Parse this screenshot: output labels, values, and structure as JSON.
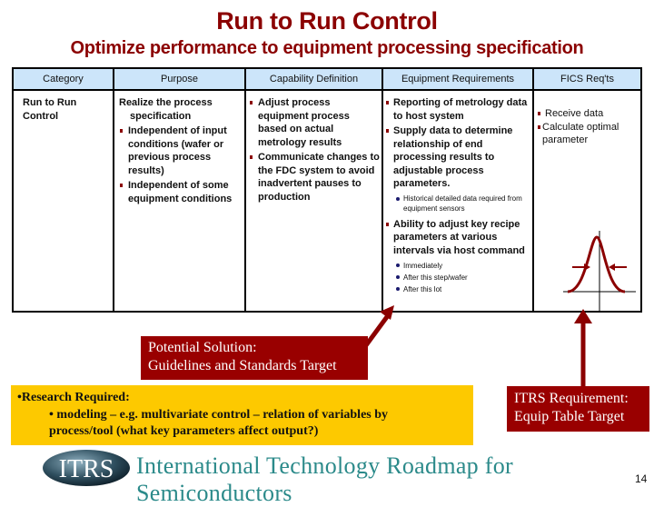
{
  "title": "Run to Run Control",
  "subtitle": "Optimize performance to equipment processing specification",
  "table": {
    "headers": [
      "Category",
      "Purpose",
      "Capability Definition",
      "Equipment Requirements",
      "FICS Req'ts"
    ],
    "category": [
      "Run to Run",
      "Control"
    ],
    "purpose": {
      "intro": "Realize the process specification",
      "bullets": [
        "Independent of input conditions (wafer or previous process results)",
        "Independent of some equipment conditions"
      ]
    },
    "capability": {
      "bullets": [
        "Adjust process equipment process based on actual metrology results",
        "Communicate changes to the FDC system to avoid inadvertent pauses to production"
      ]
    },
    "equipment": {
      "b1": "Reporting of metrology data to host system",
      "b2": "Supply data to determine relationship of end processing results to adjustable process parameters.",
      "b2_sub": [
        "Historical detailed data required from equipment sensors"
      ],
      "b3": "Ability to adjust key recipe parameters at various intervals via host command",
      "b3_sub": [
        "Immediately",
        "After this step/wafer",
        "After this lot"
      ]
    },
    "fics": {
      "bullets": [
        "Receive data",
        "Calculate optimal parameter"
      ]
    }
  },
  "potential_solution": {
    "line1": "Potential Solution:",
    "line2": "Guidelines and Standards Target"
  },
  "research": {
    "heading": "•Research Required:",
    "item": "• modeling – e.g. multivariate control – relation of variables by process/tool (what key parameters affect output?)"
  },
  "itrs_requirement": {
    "line1": "ITRS Requirement:",
    "line2": "Equip Table Target"
  },
  "footer": {
    "logo": "ITRS",
    "text": "International Technology Roadmap for Semiconductors",
    "page": "14"
  },
  "colors": {
    "title": "#8b0000",
    "header_bg": "#cce5fa",
    "callout": "#990000",
    "research_bg": "#fdc900",
    "footer_text": "#2b8a8a"
  }
}
